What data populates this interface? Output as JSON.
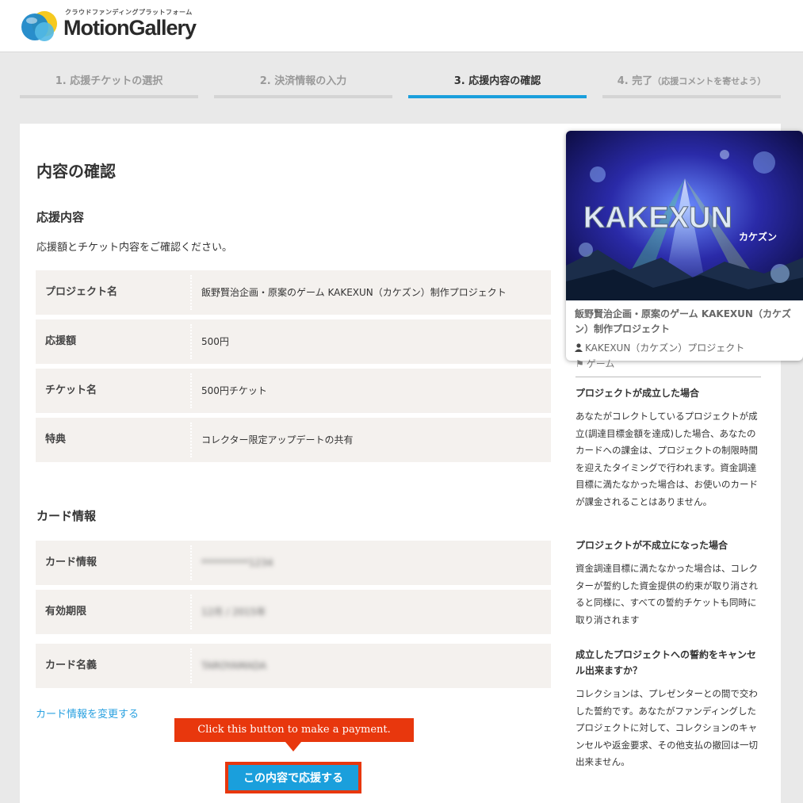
{
  "header": {
    "tagline": "クラウドファンディングプラットフォーム",
    "logo_text": "MotionGallery"
  },
  "steps": [
    {
      "label": "1.  応援チケットの選択",
      "sub": "",
      "active": false
    },
    {
      "label": "2.  決済情報の入力",
      "sub": "",
      "active": false
    },
    {
      "label": "3.  応援内容の確認",
      "sub": "",
      "active": true
    },
    {
      "label": "4.  完了",
      "sub": "（応援コメントを寄せよう）",
      "active": false
    }
  ],
  "main": {
    "title": "内容の確認",
    "support_section": {
      "title": "応援内容",
      "intro": "応援額とチケット内容をご確認ください。",
      "rows": [
        {
          "label": "プロジェクト名",
          "value": "飯野賢治企画・原案のゲーム KAKEXUN（カケズン）制作プロジェクト"
        },
        {
          "label": "応援額",
          "value": "500円"
        },
        {
          "label": "チケット名",
          "value": "500円チケット"
        },
        {
          "label": "特典",
          "value": "コレクター限定アップデートの共有"
        }
      ]
    },
    "card_section": {
      "title": "カード情報",
      "rows": [
        {
          "label": "カード情報",
          "value": "**********1234"
        },
        {
          "label": "有効期限",
          "value": "12月 / 2015年"
        },
        {
          "label": "カード名義",
          "value": "TAROYAMADA"
        }
      ]
    },
    "change_card_link": "カード情報を変更する",
    "callout": "Click this button to make a payment.",
    "submit_label": "この内容で応援する"
  },
  "sidebar": {
    "card": {
      "image_logo": "KAKEXUN",
      "image_logo_kana": "カケズン",
      "title": "飯野賢治企画・原案のゲーム KAKEXUN（カケズン）制作プロジェクト",
      "owner": "KAKEXUN（カケズン）プロジェクト"
    },
    "tag": "ゲーム",
    "faq": [
      {
        "q": "プロジェクトが成立した場合",
        "a": "あなたがコレクトしているプロジェクトが成立(調達目標金額を達成)した場合、あなたのカードへの課金は、プロジェクトの制限時間を迎えたタイミングで行われます。資金調達目標に満たなかった場合は、お使いのカードが課金されることはありません。"
      },
      {
        "q": "プロジェクトが不成立になった場合",
        "a": "資金調達目標に満たなかった場合は、コレクターが誓約した資金提供の約束が取り消されると同様に、すべての誓約チケットも同時に取り消されます"
      },
      {
        "q": "成立したプロジェクトへの誓約をキャンセル出来ますか？",
        "a": "コレクションは、プレゼンターとの間で交わした誓約です。あなたがファンディングしたプロジェクトに対して、コレクションのキャンセルや返金要求、その他支払の撤回は一切出来ません。"
      }
    ]
  },
  "colors": {
    "accent": "#1a9fdc",
    "callout": "#e8370d",
    "row_bg": "#f4f1ee",
    "link": "#2aa1e0"
  }
}
